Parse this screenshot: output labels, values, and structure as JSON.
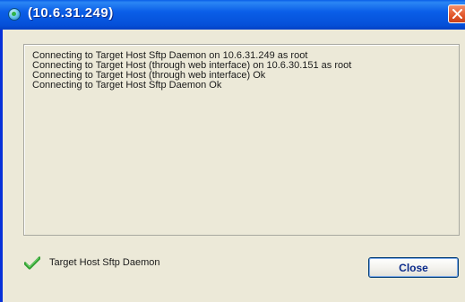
{
  "window": {
    "title": "(10.6.31.249)",
    "icons": {
      "app": "app-icon",
      "close": "close-icon"
    }
  },
  "log": {
    "lines": [
      "Connecting to Target Host Sftp Daemon on 10.6.31.249 as root",
      "Connecting to Target Host (through web interface) on 10.6.30.151 as root",
      "Connecting to Target Host (through web interface) Ok",
      "Connecting to Target Host Sftp Daemon Ok"
    ]
  },
  "status": {
    "icon": "check-icon",
    "label": "Target Host Sftp Daemon"
  },
  "buttons": {
    "close_label": "Close"
  },
  "colors": {
    "titlebar": "#0a5ee8",
    "window_bg": "#ece9d8",
    "check": "#2f9e2f",
    "close_x": "#e2572b"
  }
}
